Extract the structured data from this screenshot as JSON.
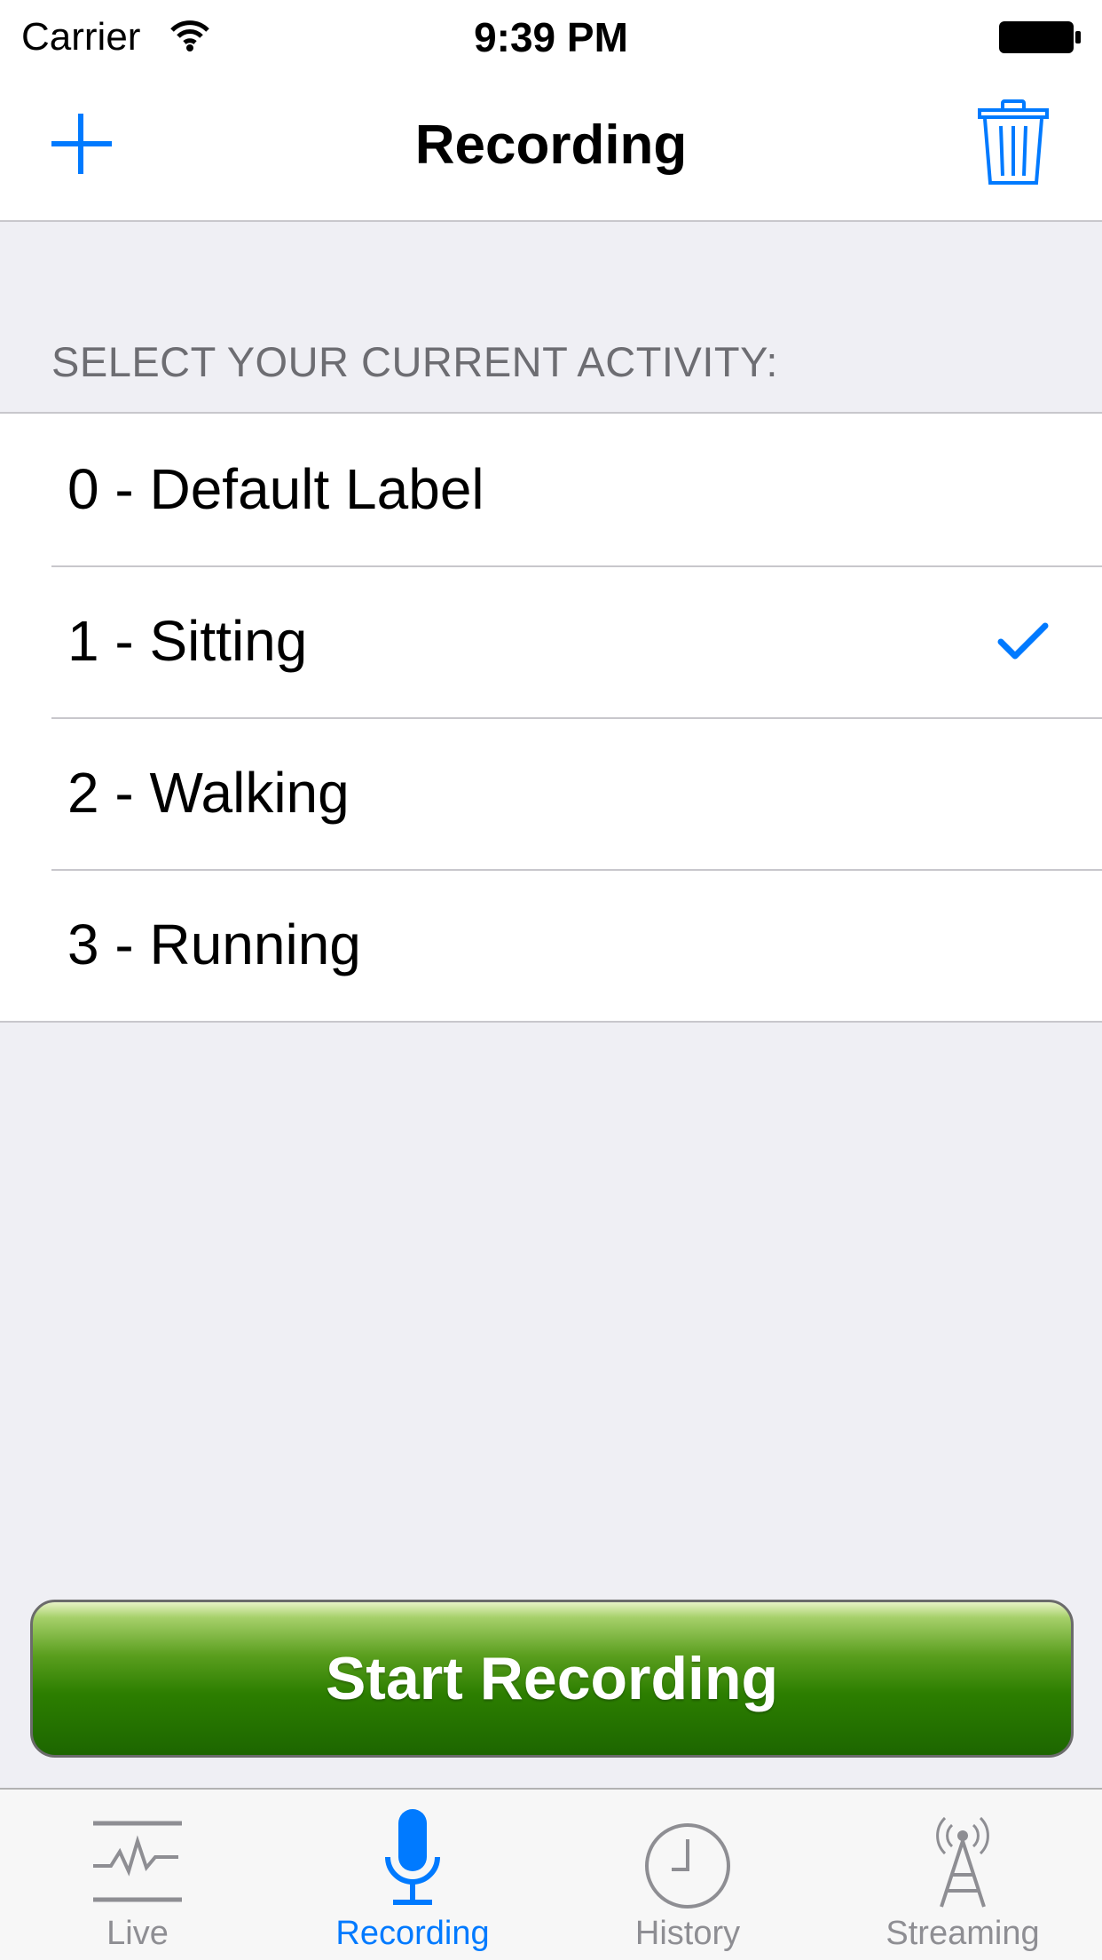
{
  "status_bar": {
    "carrier": "Carrier",
    "time": "9:39 PM"
  },
  "nav": {
    "title": "Recording",
    "left_icon": "plus-icon",
    "right_icon": "trash-icon"
  },
  "section_header": "SELECT YOUR CURRENT ACTIVITY:",
  "activities": [
    {
      "label": "0 - Default Label",
      "selected": false
    },
    {
      "label": "1 - Sitting",
      "selected": true
    },
    {
      "label": "2 - Walking",
      "selected": false
    },
    {
      "label": "3 - Running",
      "selected": false
    }
  ],
  "start_button": {
    "label": "Start Recording"
  },
  "tabs": [
    {
      "label": "Live",
      "icon": "pulse-chart-icon",
      "active": false
    },
    {
      "label": "Recording",
      "icon": "microphone-icon",
      "active": true
    },
    {
      "label": "History",
      "icon": "clock-icon",
      "active": false
    },
    {
      "label": "Streaming",
      "icon": "antenna-tower-icon",
      "active": false
    }
  ],
  "colors": {
    "accent": "#007aff",
    "background": "#efeff4",
    "button_green": "#2c7e00",
    "tab_inactive": "#8e8e93"
  }
}
